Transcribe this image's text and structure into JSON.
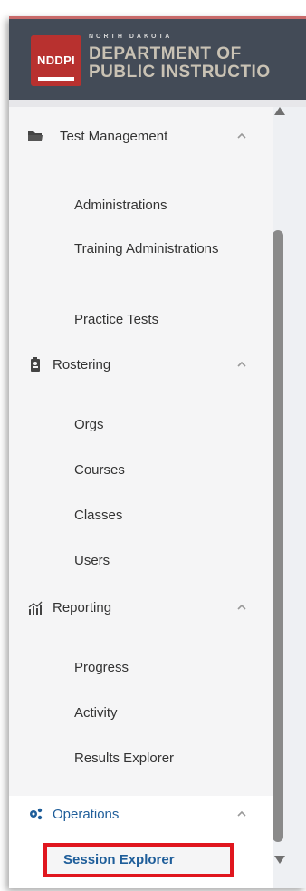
{
  "header": {
    "badge": "NDDPI",
    "subtitle": "NORTH DAKOTA",
    "line1": "DEPARTMENT OF",
    "line2": "PUBLIC INSTRUCTIO"
  },
  "sections": [
    {
      "label": "Test Management",
      "items": [
        "Administrations",
        "Training Administrations",
        "Practice Tests"
      ]
    },
    {
      "label": "Rostering",
      "items": [
        "Orgs",
        "Courses",
        "Classes",
        "Users"
      ]
    },
    {
      "label": "Reporting",
      "items": [
        "Progress",
        "Activity",
        "Results Explorer"
      ]
    },
    {
      "label": "Operations",
      "items": [
        "Session Explorer"
      ]
    }
  ],
  "colors": {
    "header_bg": "#434b57",
    "badge_red": "#b8312f",
    "accent_blue": "#1f5e9a",
    "highlight_red": "#e0161e"
  }
}
